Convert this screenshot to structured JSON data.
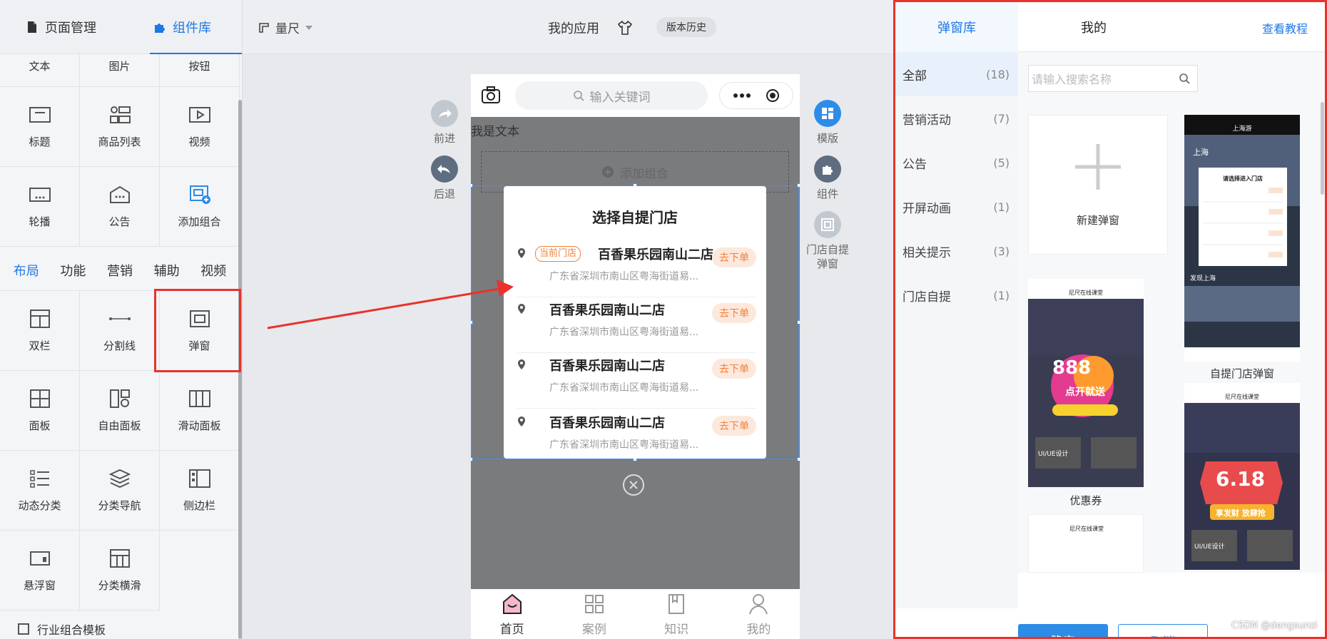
{
  "left_panel": {
    "tabs": [
      {
        "label": "页面管理",
        "icon": "page-icon"
      },
      {
        "label": "组件库",
        "icon": "puzzle-icon"
      }
    ],
    "top_items": [
      {
        "label": "文本",
        "icon": "text-icon"
      },
      {
        "label": "图片",
        "icon": "image-icon"
      },
      {
        "label": "按钮",
        "icon": "button-icon"
      },
      {
        "label": "标题",
        "icon": "title-icon"
      },
      {
        "label": "商品列表",
        "icon": "goods-list-icon"
      },
      {
        "label": "视频",
        "icon": "video-icon"
      },
      {
        "label": "轮播",
        "icon": "carousel-icon"
      },
      {
        "label": "公告",
        "icon": "notice-icon"
      },
      {
        "label": "添加组合",
        "icon": "add-combo-icon"
      }
    ],
    "sub_tabs": [
      "布局",
      "功能",
      "营销",
      "辅助",
      "视频"
    ],
    "layout_items": [
      {
        "label": "双栏",
        "icon": "two-column-icon"
      },
      {
        "label": "分割线",
        "icon": "divider-icon"
      },
      {
        "label": "弹窗",
        "icon": "popup-icon"
      },
      {
        "label": "面板",
        "icon": "panel-icon"
      },
      {
        "label": "自由面板",
        "icon": "free-panel-icon"
      },
      {
        "label": "滑动面板",
        "icon": "slide-panel-icon"
      },
      {
        "label": "动态分类",
        "icon": "dynamic-category-icon"
      },
      {
        "label": "分类导航",
        "icon": "category-nav-icon"
      },
      {
        "label": "侧边栏",
        "icon": "sidebar-icon"
      },
      {
        "label": "悬浮窗",
        "icon": "float-window-icon"
      },
      {
        "label": "分类横滑",
        "icon": "category-scroll-icon"
      }
    ],
    "industry_template": "行业组合模板"
  },
  "topbar": {
    "ruler_label": "量尺",
    "app_title": "我的应用",
    "history_label": "版本历史"
  },
  "canvas": {
    "left_actions": [
      {
        "label": "前进",
        "icon": "forward-icon"
      },
      {
        "label": "后退",
        "icon": "back-icon"
      }
    ],
    "right_actions": [
      {
        "label": "模版",
        "icon": "template-icon"
      },
      {
        "label": "组件",
        "icon": "component-icon"
      },
      {
        "label": "门店自提弹窗",
        "icon": "store-popup-icon"
      }
    ]
  },
  "phone": {
    "search_placeholder": "输入关键词",
    "text_component": "我是文本",
    "add_combo": "添加组合",
    "popup": {
      "title": "选择自提门店",
      "current_badge": "当前门店",
      "stores": [
        {
          "name": "百香果乐园南山二店",
          "address": "广东省深圳市南山区粤海街道易...",
          "action": "去下单",
          "current": true
        },
        {
          "name": "百香果乐园南山二店",
          "address": "广东省深圳市南山区粤海街道易...",
          "action": "去下单",
          "current": false
        },
        {
          "name": "百香果乐园南山二店",
          "address": "广东省深圳市南山区粤海街道易...",
          "action": "去下单",
          "current": false
        },
        {
          "name": "百香果乐园南山二店",
          "address": "广东省深圳市南山区粤海街道易...",
          "action": "去下单",
          "current": false
        }
      ]
    },
    "tabbar": [
      {
        "label": "首页",
        "icon": "home-icon",
        "active": true
      },
      {
        "label": "案例",
        "icon": "cases-icon",
        "active": false
      },
      {
        "label": "知识",
        "icon": "knowledge-icon",
        "active": false
      },
      {
        "label": "我的",
        "icon": "profile-icon",
        "active": false
      }
    ]
  },
  "right_panel": {
    "tabs": [
      "弹窗库",
      "我的"
    ],
    "tutorial_link": "查看教程",
    "categories": [
      {
        "label": "全部",
        "count": "(18)"
      },
      {
        "label": "营销活动",
        "count": "(7)"
      },
      {
        "label": "公告",
        "count": "(5)"
      },
      {
        "label": "开屏动画",
        "count": "(1)"
      },
      {
        "label": "相关提示",
        "count": "(3)"
      },
      {
        "label": "门店自提",
        "count": "(1)"
      }
    ],
    "search_placeholder": "请输入搜索名称",
    "new_popup_label": "新建弹窗",
    "templates": [
      {
        "caption": "自提门店弹窗",
        "thumb_title": "上海游",
        "thumb_popup_title": "请选择进入门店",
        "thumb_location": "上海",
        "thumb_section": "发现上海"
      },
      {
        "caption": "优惠券",
        "thumb_title": "尼尺在线课堂",
        "thumb_banner": "888",
        "thumb_banner_sub": "点开就送",
        "thumb_card": "UI/UE设计"
      },
      {
        "caption": "",
        "thumb_title": "尼尺在线课堂",
        "thumb_banner": "6.18",
        "thumb_banner_sub": "享发财 放肆抢",
        "thumb_card": "UI/UE设计"
      },
      {
        "caption": "",
        "thumb_title": "尼尺在线课堂"
      }
    ],
    "confirm_label": "确定",
    "cancel_label": "取消"
  },
  "watermark": "CSDN @dengsunzi",
  "colors": {
    "accent": "#1e78e6",
    "highlight": "#e8322b",
    "order": "#f0813a"
  }
}
